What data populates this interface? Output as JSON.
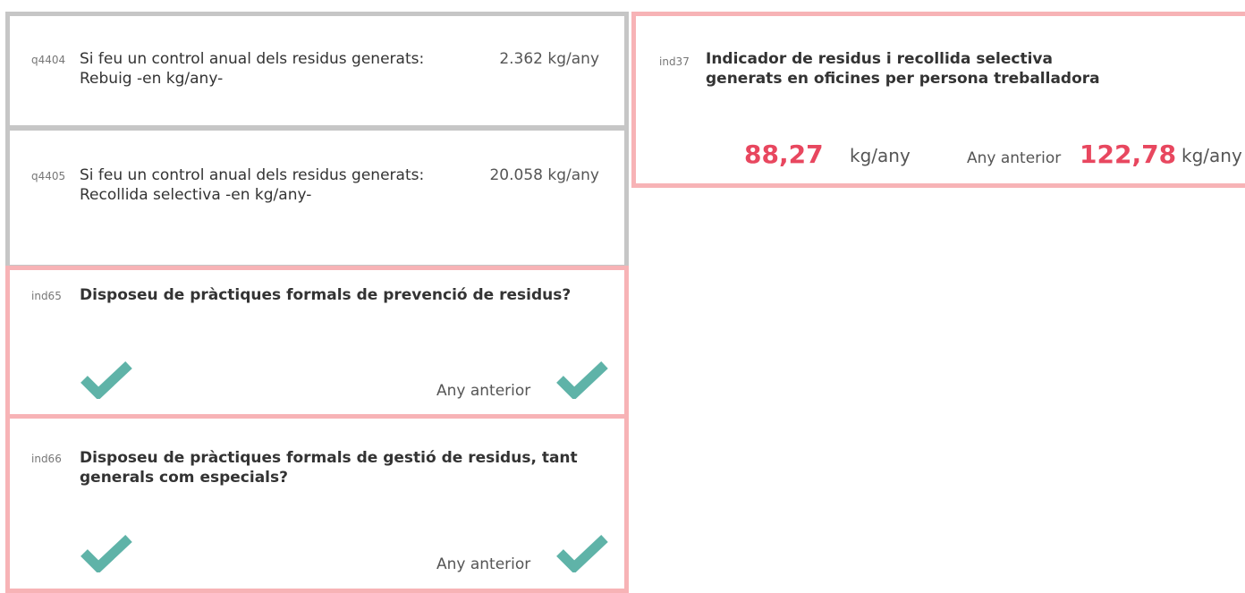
{
  "colors": {
    "grey_border": "#c6c6c6",
    "pink_border": "#f7b3b6",
    "accent_red": "#e8475f",
    "check_teal": "#5fb3a8"
  },
  "q4404": {
    "code": "q4404",
    "text": "Si feu un control anual dels residus generats: Rebuig -en kg/any-",
    "value": "2.362 kg/any"
  },
  "q4405": {
    "code": "q4405",
    "text": "Si feu un control anual dels residus generats: Recollida selectiva -en kg/any-",
    "value": "20.058 kg/any"
  },
  "ind65": {
    "code": "ind65",
    "title": "Disposeu de pràctiques formals de prevenció de residus?",
    "current_icon": "check-icon",
    "previous_label": "Any anterior",
    "previous_icon": "check-icon"
  },
  "ind66": {
    "code": "ind66",
    "title": "Disposeu de pràctiques formals de gestió de residus, tant generals com especials?",
    "current_icon": "check-icon",
    "previous_label": "Any anterior",
    "previous_icon": "check-icon"
  },
  "ind37": {
    "code": "ind37",
    "title_line1": "Indicador de residus i recollida selectiva",
    "title_line2": "generats en oficines per persona treballadora",
    "current_value": "88,27",
    "current_unit": "kg/any",
    "previous_label": "Any anterior",
    "previous_value": "122,78",
    "previous_unit": "kg/any"
  }
}
